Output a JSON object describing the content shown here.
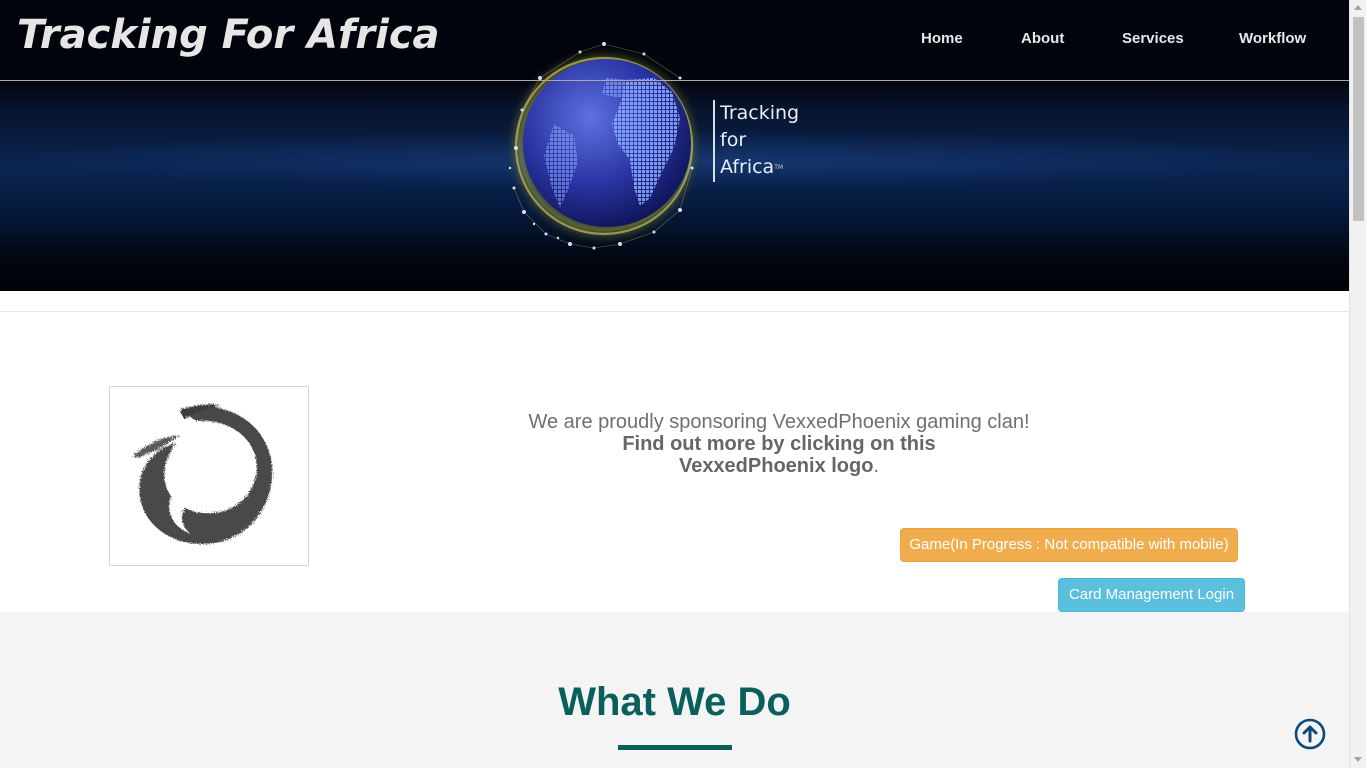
{
  "header": {
    "brand": "Tracking For Africa",
    "nav": [
      {
        "label": "Home"
      },
      {
        "label": "About"
      },
      {
        "label": "Services"
      },
      {
        "label": "Workflow"
      }
    ]
  },
  "hero": {
    "logo_lines": [
      "Tracking",
      "for",
      "Africa"
    ],
    "trademark": "TM"
  },
  "sponsor": {
    "line1": "We are proudly sponsoring VexxedPhoenix gaming clan!",
    "line2": "Find out more by clicking on this",
    "line3_bold": "VexxedPhoenix logo",
    "line3_end": ".",
    "logo_icon": "vexxedphoenix-logo"
  },
  "buttons": {
    "game": "Game(In Progress : Not compatible with mobile)",
    "card": "Card Management Login"
  },
  "what_we_do": {
    "title": "What We Do"
  },
  "colors": {
    "accent": "#0b5f5a",
    "warning": "#f0ad4e",
    "info": "#5bc0de"
  }
}
